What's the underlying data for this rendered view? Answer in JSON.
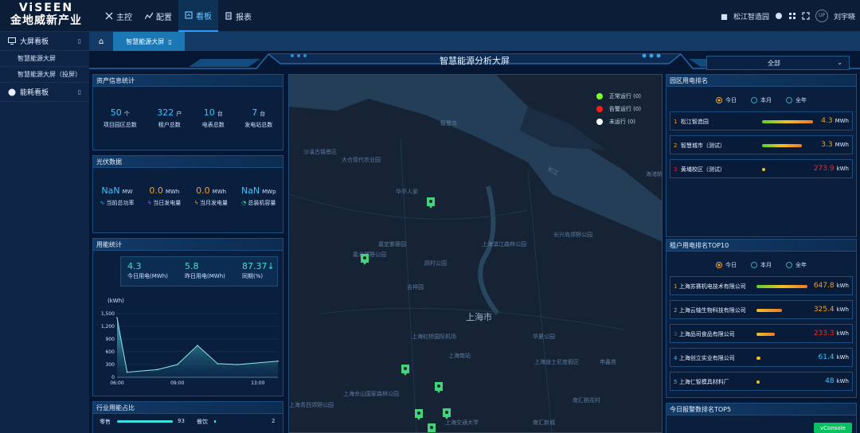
{
  "logo": {
    "line1": "ViSEEN",
    "line2": "金地威新产业"
  },
  "nav": [
    {
      "label": "主控",
      "icon": "tools-icon"
    },
    {
      "label": "配置",
      "icon": "chart-icon"
    },
    {
      "label": "看板",
      "icon": "dashboard-icon"
    },
    {
      "label": "报表",
      "icon": "report-icon"
    }
  ],
  "header_right": {
    "project": "松江智造园",
    "user": "刘宇晓"
  },
  "sidebar": {
    "groups": [
      {
        "label": "大屏看板",
        "subitems": [
          "智慧能源大屏",
          "智慧能源大屏（投屏）"
        ]
      },
      {
        "label": "能耗看板",
        "subitems": []
      }
    ]
  },
  "tab": {
    "label": "智慧能源大屏"
  },
  "screen": {
    "title": "智慧能源分析大屏",
    "dropdown_value": "全部"
  },
  "asset": {
    "title": "资产信息统计",
    "items": [
      {
        "value": "50",
        "unit": "个",
        "label": "项目园区总数"
      },
      {
        "value": "322",
        "unit": "户",
        "label": "租户总数"
      },
      {
        "value": "10",
        "unit": "台",
        "label": "电表总数"
      },
      {
        "value": "7",
        "unit": "台",
        "label": "发电站总数"
      }
    ]
  },
  "pv": {
    "title": "光伏数据",
    "items": [
      {
        "value": "NaN",
        "unit": "MW",
        "label": "当前总功率",
        "color": "#38c6ff"
      },
      {
        "value": "0.0",
        "unit": "MWh",
        "label": "当日发电量",
        "color": "#f0a028"
      },
      {
        "value": "0.0",
        "unit": "MWh",
        "label": "当月发电量",
        "color": "#f0a028"
      },
      {
        "value": "NaN",
        "unit": "MWp",
        "label": "总装机容量",
        "color": "#38c6ff"
      }
    ]
  },
  "energy": {
    "title": "用能统计",
    "items": [
      {
        "value": "4.3",
        "label": "今日用电(MWh)"
      },
      {
        "value": "5.8",
        "label": "昨日用电(MWh)"
      },
      {
        "value": "87.37↓",
        "label": "同期(%)"
      }
    ]
  },
  "chart_data": {
    "type": "area",
    "ylabel": "(kWh)",
    "y_ticks": [
      "1,500",
      "1,200",
      "900",
      "600",
      "300",
      "0"
    ],
    "x_ticks": [
      "06:00",
      "09:00",
      "13:00"
    ],
    "ylim": [
      0,
      1500
    ],
    "x": [
      6,
      6.5,
      8,
      9,
      10,
      11,
      12,
      14
    ],
    "values": [
      1400,
      120,
      180,
      300,
      750,
      320,
      300,
      380
    ]
  },
  "industry": {
    "title": "行业用能占比",
    "rows": [
      {
        "name": "零售",
        "value": "93",
        "name2": "餐饮",
        "value2": "2"
      }
    ]
  },
  "map": {
    "city": "上海市",
    "legend": [
      {
        "label": "正常运行 (0)",
        "color": "#7cff2b"
      },
      {
        "label": "告警运行 (0)",
        "color": "#ff1a1a"
      },
      {
        "label": "未运行 (0)",
        "color": "#ffffff"
      }
    ],
    "labels": [
      "智慧岛",
      "沙溪古镇景区",
      "大仓现代农业园",
      "华亭人家",
      "嘉定紫藤园",
      "嘉北郊野公园",
      "顾村公园",
      "吉祥园",
      "上海虹桥国际机场",
      "上海南站",
      "华夏公园",
      "上海迪士尼度假区",
      "上海滨江森林公园",
      "长兴岛郊野公园",
      "上海佘山国家森林公园",
      "上海交通大学",
      "长江",
      "南汇新城",
      "上海青西郊野公园",
      "南汇桃花村",
      "申鑫苑",
      "海港新城"
    ]
  },
  "park_rank": {
    "title": "园区用电排名",
    "radio": [
      "今日",
      "本月",
      "全年"
    ],
    "rows": [
      {
        "rank": "1",
        "name": "松江智造园",
        "value": "4.3",
        "unit": "MWh",
        "color": "#f0a028"
      },
      {
        "rank": "2",
        "name": "智慧城市（测试）",
        "value": "3.3",
        "unit": "MWh",
        "color": "#f0a028"
      },
      {
        "rank": "3",
        "name": "黄埔校区（测试）",
        "value": "273.9",
        "unit": "kWh",
        "color": "#ff2222"
      }
    ]
  },
  "tenant_rank": {
    "title": "租户用电排名TOP10",
    "radio": [
      "今日",
      "本月",
      "全年"
    ],
    "rows": [
      {
        "rank": "1",
        "name": "上海苏赛机电技术有限公司",
        "value": "647.8",
        "unit": "kWh",
        "color": "#f0a028"
      },
      {
        "rank": "2",
        "name": "上海云轴生物科技有限公司",
        "value": "325.4",
        "unit": "kWh",
        "color": "#f0a028"
      },
      {
        "rank": "3",
        "name": "上海品司食品有限公司",
        "value": "233.3",
        "unit": "kWh",
        "color": "#ff2222"
      },
      {
        "rank": "4",
        "name": "上海创立实业有限公司",
        "value": "61.4",
        "unit": "kWh",
        "color": "#38c6ff"
      },
      {
        "rank": "5",
        "name": "上海仁智模具材料厂",
        "value": "48",
        "unit": "kWh",
        "color": "#38c6ff"
      }
    ]
  },
  "alarm_rank": {
    "title": "今日报警数排名TOP5"
  },
  "vconsole": {
    "label": "vConsole"
  }
}
